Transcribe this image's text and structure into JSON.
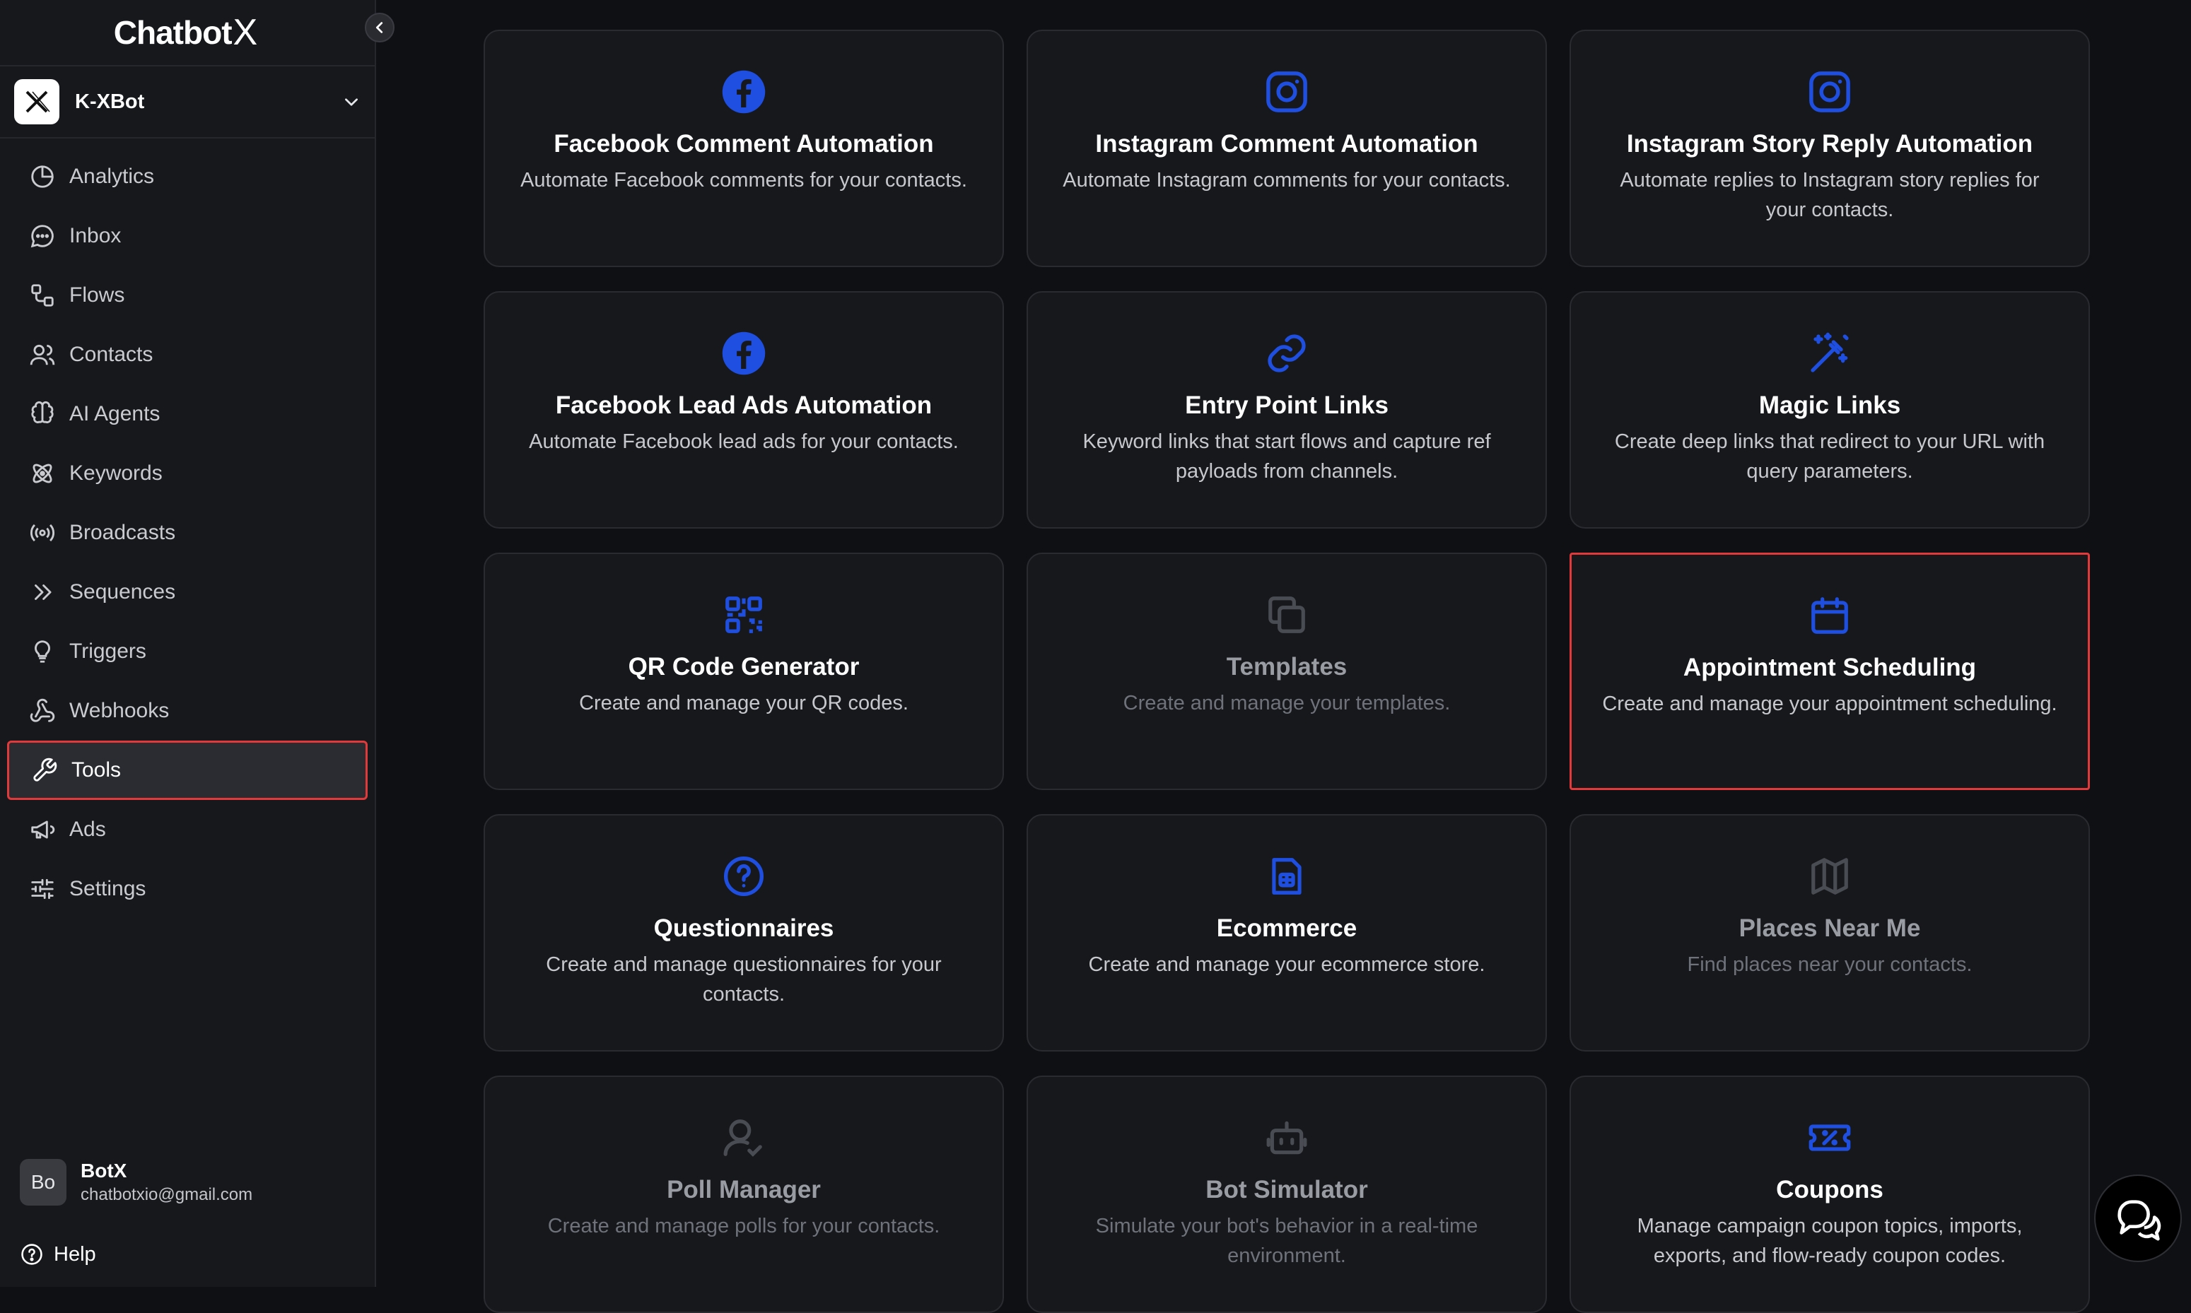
{
  "app": {
    "logo_text": "Chatbot",
    "logo_x": "X"
  },
  "bot": {
    "name": "K-XBot"
  },
  "sidebar": {
    "items": [
      {
        "label": "Analytics",
        "icon": "pie-chart-icon"
      },
      {
        "label": "Inbox",
        "icon": "chat-bubble-icon"
      },
      {
        "label": "Flows",
        "icon": "flow-icon"
      },
      {
        "label": "Contacts",
        "icon": "users-icon"
      },
      {
        "label": "AI Agents",
        "icon": "brain-icon"
      },
      {
        "label": "Keywords",
        "icon": "atom-icon"
      },
      {
        "label": "Broadcasts",
        "icon": "broadcast-icon"
      },
      {
        "label": "Sequences",
        "icon": "double-chevron-icon"
      },
      {
        "label": "Triggers",
        "icon": "lightbulb-icon"
      },
      {
        "label": "Webhooks",
        "icon": "webhook-icon"
      },
      {
        "label": "Tools",
        "icon": "wrench-icon",
        "active": true
      },
      {
        "label": "Ads",
        "icon": "megaphone-icon"
      },
      {
        "label": "Settings",
        "icon": "sliders-icon"
      }
    ]
  },
  "user": {
    "initials": "Bo",
    "name": "BotX",
    "email": "chatbotxio@gmail.com"
  },
  "help": {
    "label": "Help"
  },
  "colors": {
    "accent": "#1f4fe0",
    "muted_icon": "#4a4c53",
    "highlight": "#e23a3a"
  },
  "tools": [
    {
      "title": "Facebook Comment Automation",
      "desc": "Automate Facebook comments for your contacts.",
      "icon": "facebook-icon"
    },
    {
      "title": "Instagram Comment Automation",
      "desc": "Automate Instagram comments for your contacts.",
      "icon": "instagram-icon"
    },
    {
      "title": "Instagram Story Reply Automation",
      "desc": "Automate replies to Instagram story replies for your contacts.",
      "icon": "instagram-icon"
    },
    {
      "title": "Facebook Lead Ads Automation",
      "desc": "Automate Facebook lead ads for your contacts.",
      "icon": "facebook-icon"
    },
    {
      "title": "Entry Point Links",
      "desc": "Keyword links that start flows and capture ref payloads from channels.",
      "icon": "link-icon"
    },
    {
      "title": "Magic Links",
      "desc": "Create deep links that redirect to your URL with query parameters.",
      "icon": "magic-wand-icon"
    },
    {
      "title": "QR Code Generator",
      "desc": "Create and manage your QR codes.",
      "icon": "qr-code-icon"
    },
    {
      "title": "Templates",
      "desc": "Create and manage your templates.",
      "icon": "copy-icon",
      "disabled": true
    },
    {
      "title": "Appointment Scheduling",
      "desc": "Create and manage your appointment scheduling.",
      "icon": "calendar-icon",
      "highlight": true
    },
    {
      "title": "Questionnaires",
      "desc": "Create and manage questionnaires for your contacts.",
      "icon": "question-circle-icon"
    },
    {
      "title": "Ecommerce",
      "desc": "Create and manage your ecommerce store.",
      "icon": "store-icon"
    },
    {
      "title": "Places Near Me",
      "desc": "Find places near your contacts.",
      "icon": "map-icon",
      "disabled": true
    },
    {
      "title": "Poll Manager",
      "desc": "Create and manage polls for your contacts.",
      "icon": "user-check-icon",
      "disabled": true
    },
    {
      "title": "Bot Simulator",
      "desc": "Simulate your bot's behavior in a real-time environment.",
      "icon": "bot-icon",
      "disabled": true
    },
    {
      "title": "Coupons",
      "desc": "Manage campaign coupon topics, imports, exports, and flow-ready coupon codes.",
      "icon": "coupon-icon"
    }
  ]
}
